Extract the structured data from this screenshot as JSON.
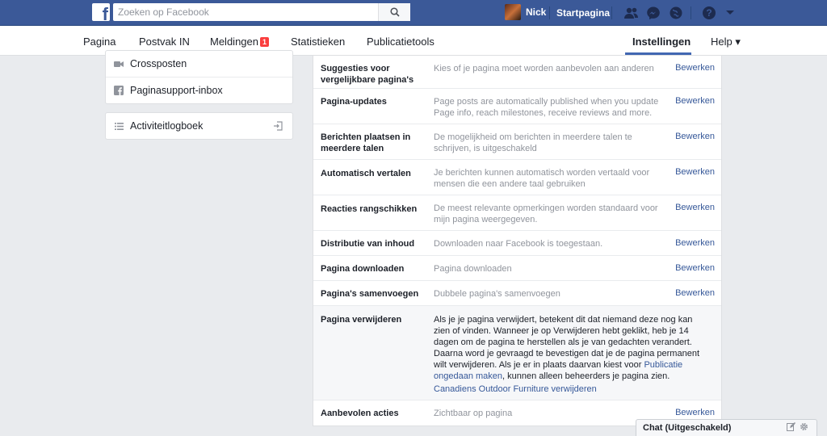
{
  "topbar": {
    "search_placeholder": "Zoeken op Facebook",
    "user_name": "Nick",
    "home_label": "Startpagina"
  },
  "pagenav": {
    "items": [
      "Pagina",
      "Postvak IN",
      "Meldingen",
      "Statistieken",
      "Publicatietools"
    ],
    "notifications_badge": "1",
    "active_label": "Instellingen",
    "help_label": "Help ▾"
  },
  "sidebar": {
    "items_top": [
      "Crossposten",
      "Paginasupport-inbox"
    ],
    "activity_log": "Activiteitlogboek"
  },
  "settings": {
    "edit_label": "Bewerken",
    "rows": [
      {
        "label": "Suggesties voor vergelijkbare pagina's",
        "desc": "Kies of je pagina moet worden aanbevolen aan anderen"
      },
      {
        "label": "Pagina-updates",
        "desc": "Page posts are automatically published when you update Page info, reach milestones, receive reviews and more."
      },
      {
        "label": "Berichten plaatsen in meerdere talen",
        "desc": "De mogelijkheid om berichten in meerdere talen te schrijven, is uitgeschakeld"
      },
      {
        "label": "Automatisch vertalen",
        "desc": "Je berichten kunnen automatisch worden vertaald voor mensen die een andere taal gebruiken"
      },
      {
        "label": "Reacties rangschikken",
        "desc": "De meest relevante opmerkingen worden standaard voor mijn pagina weergegeven."
      },
      {
        "label": "Distributie van inhoud",
        "desc": "Downloaden naar Facebook is toegestaan."
      },
      {
        "label": "Pagina downloaden",
        "desc": "Pagina downloaden"
      },
      {
        "label": "Pagina's samenvoegen",
        "desc": "Dubbele pagina's samenvoegen"
      }
    ],
    "delete": {
      "label": "Pagina verwijderen",
      "desc_part1": "Als je je pagina verwijdert, betekent dit dat niemand deze nog kan zien of vinden. Wanneer je op Verwijderen hebt geklikt, heb je 14 dagen om de pagina te herstellen als je van gedachten verandert. Daarna word je gevraagd te bevestigen dat je de pagina permanent wilt verwijderen. Als je er in plaats daarvan kiest voor ",
      "desc_link": "Publicatie ongedaan maken",
      "desc_part2": ", kunnen alleen beheerders je pagina zien.",
      "delete_link": "Canadiens Outdoor Furniture verwijderen"
    },
    "last_row": {
      "label": "Aanbevolen acties",
      "desc": "Zichtbaar op pagina"
    }
  },
  "chat": {
    "label": "Chat (Uitgeschakeld)"
  },
  "colors": {
    "brand_blue": "#3b5998",
    "link_blue": "#365899",
    "badge_red": "#fa3e3e"
  }
}
